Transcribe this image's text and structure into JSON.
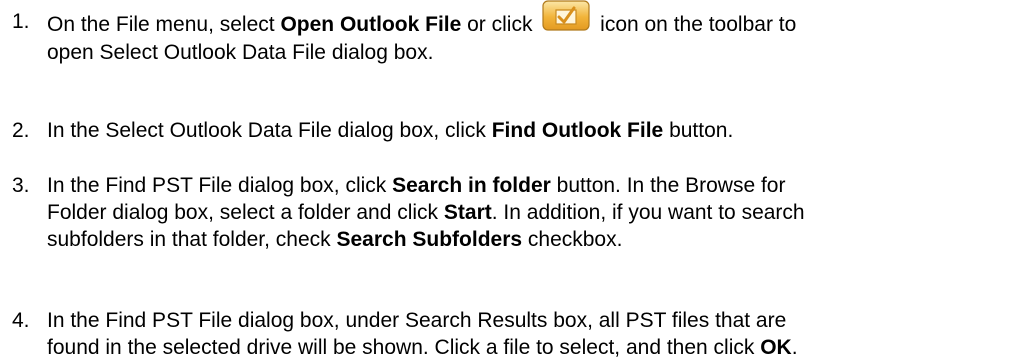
{
  "steps": [
    {
      "number": "1.",
      "parts": {
        "a": "On the File menu, select ",
        "b": "Open Outlook File",
        "c": " or click ",
        "icon": "open-outlook-file-icon",
        "d": " icon on the toolbar to",
        "e": "open Select Outlook Data File dialog box."
      }
    },
    {
      "number": "2.",
      "parts": {
        "a": "In the Select Outlook Data File dialog box, click ",
        "b": "Find Outlook File",
        "c": " button."
      }
    },
    {
      "number": "3.",
      "parts": {
        "a": "In the Find PST File dialog box, click ",
        "b": "Search in folder",
        "c": " button. In the Browse for",
        "d": "Folder dialog box, select a folder and click ",
        "e": "Start",
        "f": ". In addition, if you want to search",
        "g": "subfolders in that folder, check ",
        "h": "Search Subfolders",
        "i": " checkbox."
      }
    },
    {
      "number": "4.",
      "parts": {
        "a": "In the Find PST File dialog box, under Search Results box, all PST files that are",
        "b": "found in the selected drive will be shown. Click a file to select, and then click ",
        "c": "OK",
        "d": "."
      }
    }
  ],
  "colors": {
    "icon_fill": "#f2b43a",
    "icon_border": "#b07a1c",
    "icon_check": "#d9901c"
  }
}
